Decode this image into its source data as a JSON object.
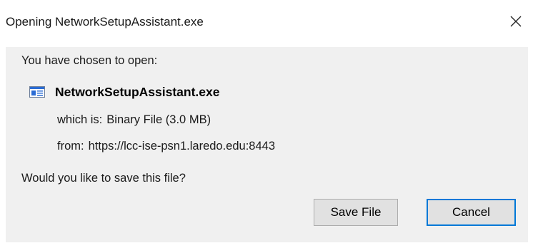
{
  "window": {
    "title": "Opening NetworkSetupAssistant.exe",
    "close_icon": "close-icon"
  },
  "dialog": {
    "intro": "You have chosen to open:",
    "file": {
      "icon": "executable-file-icon",
      "name": "NetworkSetupAssistant.exe"
    },
    "type": {
      "label": "which is:",
      "value": "Binary File (3.0 MB)"
    },
    "source": {
      "label": "from:",
      "value": "https://lcc-ise-psn1.laredo.edu:8443"
    },
    "question": "Would you like to save this file?",
    "buttons": {
      "save": "Save File",
      "cancel": "Cancel"
    }
  },
  "colors": {
    "content_background": "#f0f0f0",
    "button_background": "#e1e1e1",
    "focus_border": "#0078d7",
    "file_icon_blue": "#2b6cd4"
  }
}
